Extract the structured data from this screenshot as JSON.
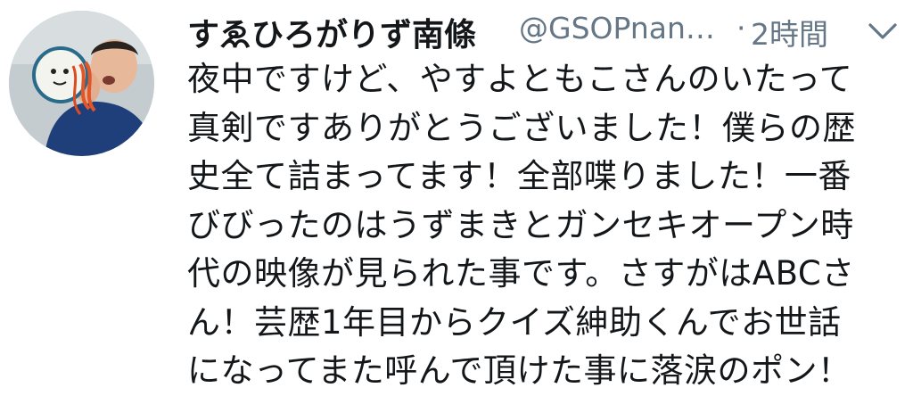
{
  "tweet": {
    "display_name": "すゑひろがりず南條",
    "handle": "@GSOPnan…",
    "separator": "·",
    "time": "2時間",
    "avatar_icon": "user-avatar-photo",
    "menu_icon": "chevron-down-icon",
    "text_lines": [
      "夜中ですけど、やすよともこさんのいたって",
      "真剣ですありがとうございました！僕らの歴",
      "史全て詰まってます！全部喋りました！一番",
      "びびったのはうずまきとガンセキオープン時",
      "代の映像が見られた事です。さすがはABCさ",
      "ん！芸歴1年目からクイズ紳助くんでお世話",
      "になってまた呼んで頂けた事に落涙のポン！"
    ]
  },
  "colors": {
    "primary_text": "#14171a",
    "secondary_text": "#657786",
    "background": "#ffffff"
  }
}
